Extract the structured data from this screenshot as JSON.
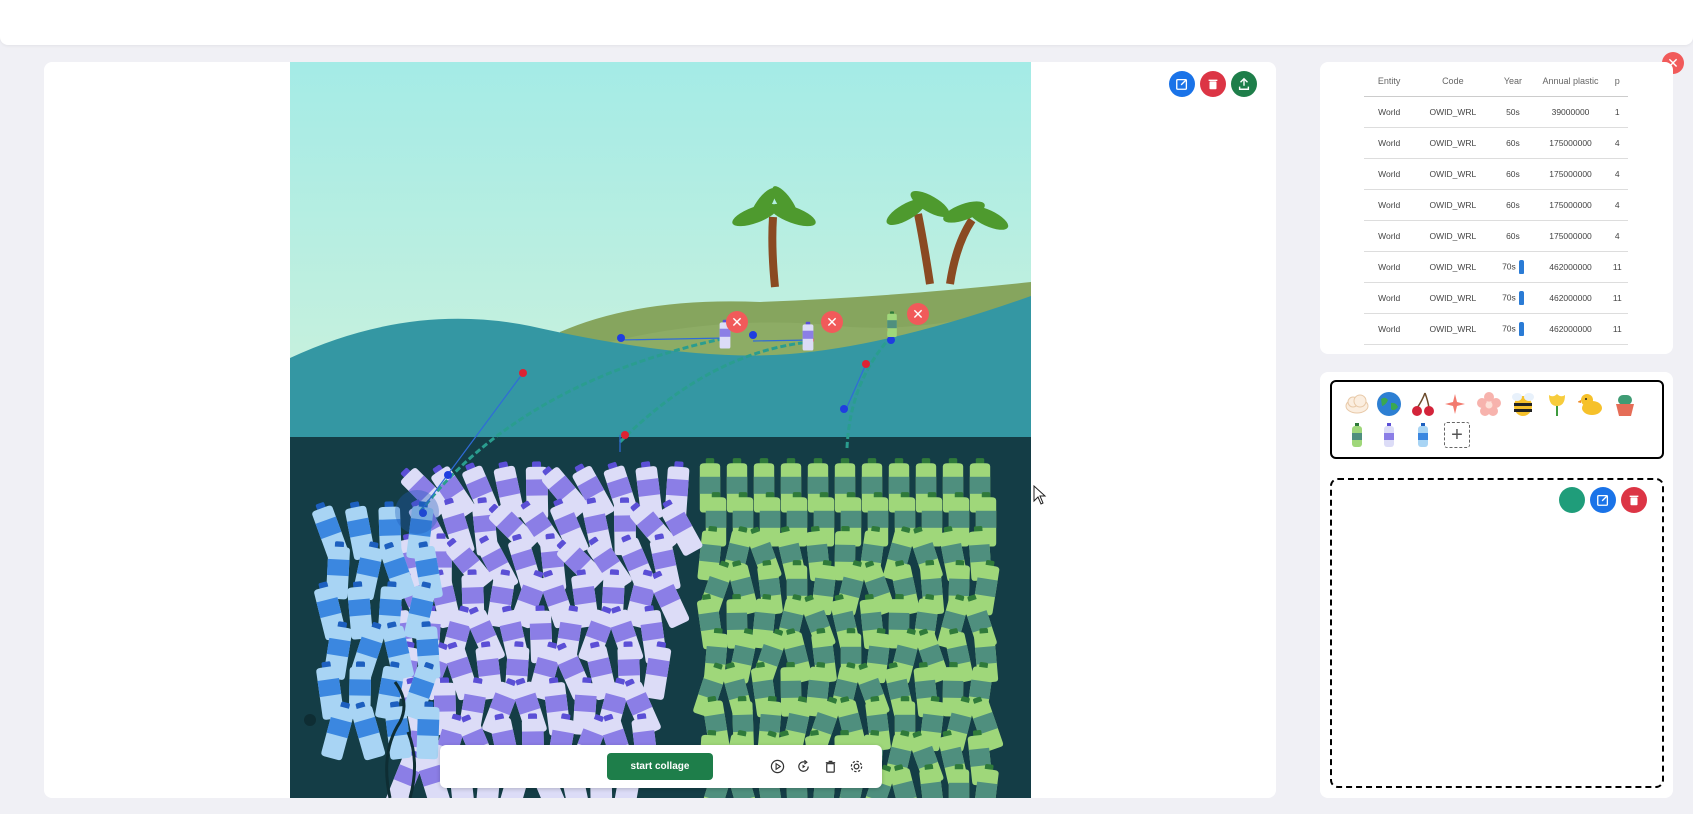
{
  "table": {
    "headers": [
      "Entity",
      "Code",
      "Year",
      "Annual plastic",
      "p"
    ],
    "rows": [
      [
        "World",
        "OWID_WRL",
        "50s",
        "39000000",
        "1"
      ],
      [
        "World",
        "OWID_WRL",
        "60s",
        "175000000",
        "4"
      ],
      [
        "World",
        "OWID_WRL",
        "60s",
        "175000000",
        "4"
      ],
      [
        "World",
        "OWID_WRL",
        "60s",
        "175000000",
        "4"
      ],
      [
        "World",
        "OWID_WRL",
        "60s",
        "175000000",
        "4"
      ],
      [
        "World",
        "OWID_WRL",
        "70s",
        "462000000",
        "11"
      ],
      [
        "World",
        "OWID_WRL",
        "70s",
        "462000000",
        "11"
      ],
      [
        "World",
        "OWID_WRL",
        "70s",
        "462000000",
        "11"
      ]
    ]
  },
  "toolbar": {
    "start_label": "start collage"
  },
  "icons": [
    "cloud",
    "earth",
    "cherries",
    "sparkles",
    "flower",
    "bee",
    "tulip",
    "duck",
    "cactus-pot",
    "green-bottle",
    "purple-bottle",
    "blue-bottle"
  ],
  "colors": {
    "sky_top": "#a8ece6",
    "sky_bottom": "#f3f7d4",
    "hill": "#8aa862",
    "sea": "#3497a3",
    "deep": "#143d46",
    "edit": "#1a73e8",
    "delete": "#dc3545",
    "export": "#1e7e4a",
    "close": "#f15a5a"
  }
}
